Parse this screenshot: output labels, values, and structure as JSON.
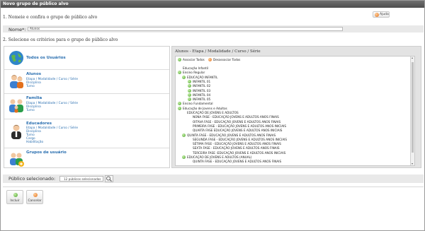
{
  "window": {
    "title": "Novo grupo de público alvo"
  },
  "help": {
    "label": "Ajuda"
  },
  "step1": {
    "title": "1. Nomeie e confira o grupo de público alvo"
  },
  "name": {
    "label": "Nome*:",
    "value": "Alunos"
  },
  "step2": {
    "title": "2. Selecione os critérios para o grupo de público alvo"
  },
  "groups": [
    {
      "title": "Todos os Usuários",
      "subs": []
    },
    {
      "title": "Alunos",
      "subs": [
        "Etapa / Modalidade / Curso / Série",
        "Disciplina",
        "Turno"
      ]
    },
    {
      "title": "Família",
      "subs": [
        "Etapa / Modalidade / Curso / Série",
        "Disciplina",
        "Turno"
      ]
    },
    {
      "title": "Educadores",
      "subs": [
        "Etapa / Modalidade / Curso / Série",
        "Disciplina",
        "Turno",
        "Cargo",
        "Habilitação"
      ]
    },
    {
      "title": "Grupos de usuário",
      "subs": []
    }
  ],
  "criteria": {
    "header": "Alunos - Etapa / Modalidade / Curso / Série",
    "associate_all": "Associar Todos",
    "disassociate_all": "Desassociar Todos",
    "tree": [
      {
        "label": "Educação Infantil",
        "level": 0,
        "icon": ""
      },
      {
        "label": "Ensino Regular",
        "level": 0,
        "icon": "green"
      },
      {
        "label": "EDUCAÇÃO INFANTIL",
        "level": 1,
        "icon": "green"
      },
      {
        "label": "INFANTIL 01",
        "level": 2,
        "icon": "green"
      },
      {
        "label": "INFANTIL 02",
        "level": 2,
        "icon": "green"
      },
      {
        "label": "INFANTIL 03",
        "level": 2,
        "icon": "green"
      },
      {
        "label": "INFANTIL 04",
        "level": 2,
        "icon": "green"
      },
      {
        "label": "INFANTIL 05",
        "level": 2,
        "icon": "green"
      },
      {
        "label": "Ensino Fundamental",
        "level": 0,
        "icon": "green"
      },
      {
        "label": "Educação de Jovens e Adultos",
        "level": 0,
        "icon": "green"
      },
      {
        "label": "EDUCAÇÃO DE JOVENS E ADULTOS",
        "level": 1,
        "icon": ""
      },
      {
        "label": "NONA FASE - EDUCAÇÃO JOVENS E ADULTOS ANOS FINAIS",
        "level": 2,
        "icon": ""
      },
      {
        "label": "OITAVA FASE - EDUCAÇÃO JOVENS E ADULTOS ANOS FINAIS",
        "level": 2,
        "icon": ""
      },
      {
        "label": "PRIMEIRA FASE - EDUCAÇÃO JOVENS E ADULTOS ANOS INICIAIS",
        "level": 2,
        "icon": ""
      },
      {
        "label": "QUARTA FASE EDUCAÇÃO JOVENS E ADULTOS ANOS INICIAIS",
        "level": 2,
        "icon": ""
      },
      {
        "label": "QUINTA FASE - EDUCAÇÃO JOVENS E ADULTOS ANOS FINAIS",
        "level": 1,
        "icon": "green"
      },
      {
        "label": "SEGUNDA FASE - EDUCAÇÃO JOVENS E ADULTOS ANOS INICIAIS",
        "level": 2,
        "icon": ""
      },
      {
        "label": "SÉTIMA FASE - EDUCAÇÃO JOVENS E ADULTOS ANOS FINAIS",
        "level": 2,
        "icon": ""
      },
      {
        "label": "SEXTA FASE - EDUCAÇÃO JOVENS E ADULTOS ANOS FINAIS",
        "level": 2,
        "icon": ""
      },
      {
        "label": "TERCEIRA FASE -EDUCAÇÃO JOVENS E ADULTOS ANOS INICIAIS",
        "level": 2,
        "icon": ""
      },
      {
        "label": "EDUCAÇÃO DE JOVENS E ADULTOS (ANUAL)",
        "level": 1,
        "icon": "green"
      },
      {
        "label": "QUINTA FASE - EDUCAÇÃO JOVENS E ADULTOS ANOS FINAIS",
        "level": 2,
        "icon": ""
      }
    ]
  },
  "selected": {
    "label": "Público selecionado:",
    "value": "12 públicos selecionados"
  },
  "actions": {
    "include": "Incluir",
    "cancel": "Cancelar"
  },
  "colors": {
    "titlebar": "#5e5e5e",
    "link": "#2a6fb0",
    "accent_green": "#4aa02c",
    "accent_orange": "#e2701c"
  }
}
